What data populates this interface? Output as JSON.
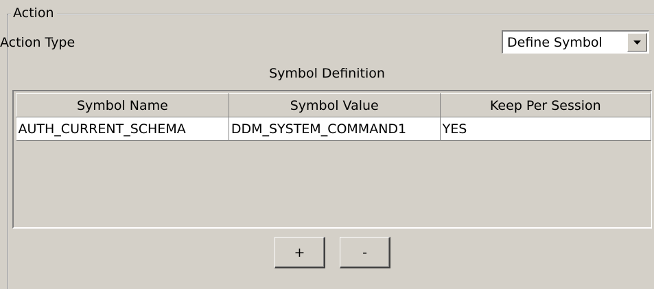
{
  "group": {
    "legend": "Action"
  },
  "action_type": {
    "label": "Action Type",
    "selected": "Define Symbol",
    "arrow_icon": "dropdown-arrow-icon"
  },
  "symbol_definition": {
    "title": "Symbol Definition",
    "columns": [
      "Symbol Name",
      "Symbol Value",
      "Keep Per Session"
    ],
    "rows": [
      [
        "AUTH_CURRENT_SCHEMA",
        "DDM_SYSTEM_COMMAND1",
        "YES"
      ]
    ]
  },
  "buttons": {
    "add": "+",
    "remove": "-"
  },
  "colors": {
    "background": "#d4d0c8",
    "field": "#ffffff",
    "shadow": "#808080",
    "highlight": "#ffffff"
  }
}
